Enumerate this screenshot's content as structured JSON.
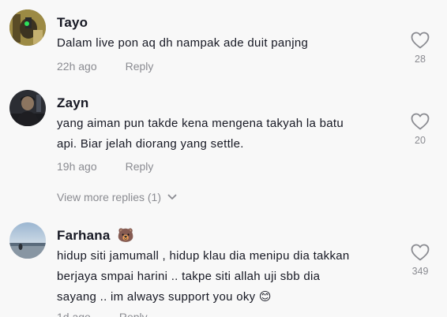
{
  "comments": [
    {
      "username": "Tayo",
      "lines": [
        "Dalam live pon aq dh nampak ade duit panjng"
      ],
      "time": "22h ago",
      "reply_label": "Reply",
      "likes": "28"
    },
    {
      "username": "Zayn",
      "lines": [
        "yang aiman pun takde kena mengena takyah la batu",
        "api. Biar jelah diorang yang settle."
      ],
      "time": "19h ago",
      "reply_label": "Reply",
      "likes": "20"
    },
    {
      "username": "Farhana",
      "username_emoji": "🐻",
      "lines": [
        "hidup siti jamumall , hidup klau dia menipu dia takkan",
        "berjaya smpai harini .. takpe siti allah uji sbb dia",
        "sayang .. im always support you oky"
      ],
      "line3_emoji": "😊",
      "time": "1d ago",
      "reply_label": "Reply",
      "likes": "349"
    }
  ],
  "view_more_replies": "View more replies (1)",
  "icons": {
    "like": "heart-outline-icon",
    "expand": "chevron-down-icon"
  },
  "colors": {
    "background": "#f8f8f8",
    "text": "#161823",
    "muted": "#8a8b91"
  }
}
